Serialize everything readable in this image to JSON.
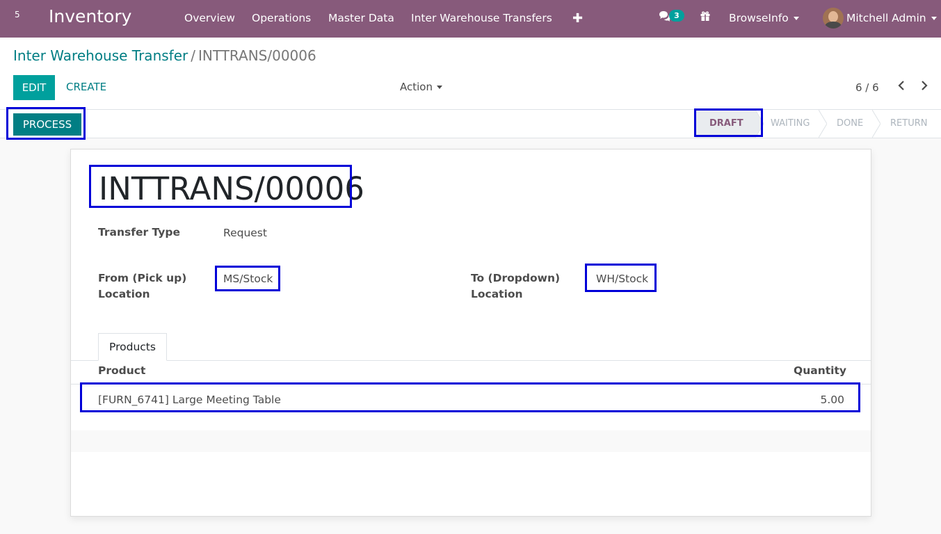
{
  "navbar": {
    "apps_count": "5",
    "app_name": "Inventory",
    "menu": [
      "Overview",
      "Operations",
      "Master Data",
      "Inter Warehouse Transfers"
    ],
    "add_icon": "plus-icon",
    "chat_icon": "comments-icon",
    "chat_count": "3",
    "gift_icon": "gift-icon",
    "company": "BrowseInfo",
    "user": "Mitchell Admin"
  },
  "breadcrumb": {
    "parent": "Inter Warehouse Transfer",
    "separator": "/",
    "current": "INTTRANS/00006"
  },
  "controls": {
    "edit_label": "EDIT",
    "create_label": "CREATE",
    "action_label": "Action",
    "pager": "6 / 6",
    "prev_icon": "chevron-left-icon",
    "next_icon": "chevron-right-icon"
  },
  "statusbar": {
    "process_label": "PROCESS",
    "stages": [
      "DRAFT",
      "WAITING",
      "DONE",
      "RETURN"
    ],
    "active_stage": "DRAFT"
  },
  "form": {
    "name": "INTTRANS/00006",
    "transfer_type_label": "Transfer Type",
    "transfer_type_value": "Request",
    "from_label_line1": "From (Pick up)",
    "from_label_line2": "Location",
    "from_value": "MS/Stock",
    "to_label_line1": "To (Dropdown)",
    "to_label_line2": "Location",
    "to_value": "WH/Stock"
  },
  "products": {
    "tab_label": "Products",
    "columns": [
      "Product",
      "Quantity"
    ],
    "rows": [
      {
        "product": "[FURN_6741] Large Meeting Table",
        "quantity": "5.00"
      }
    ]
  },
  "colors": {
    "navbar": "#875a7b",
    "primary": "#00a09d",
    "highlight": "#0000d8"
  }
}
